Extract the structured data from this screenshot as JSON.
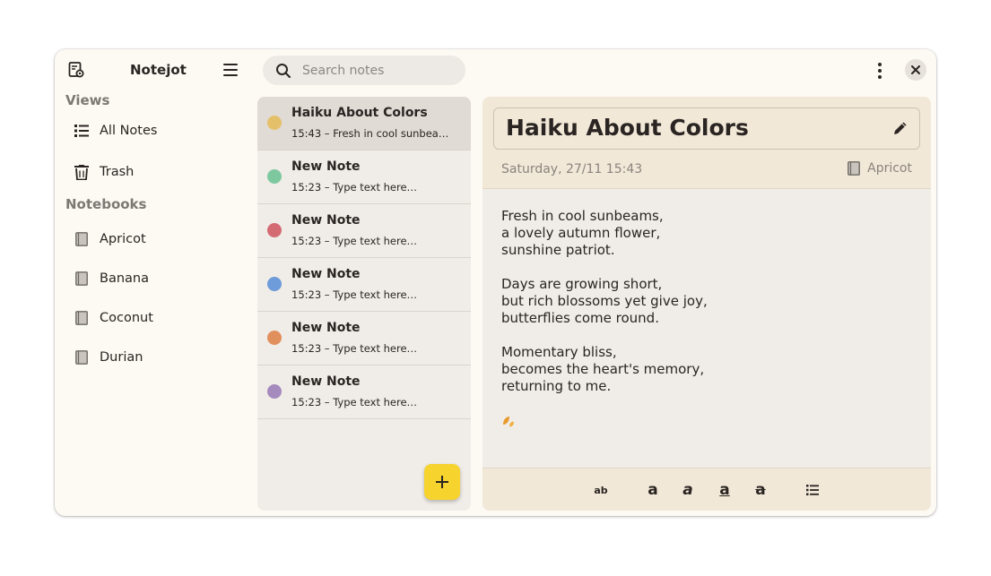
{
  "app": {
    "title": "Notejot"
  },
  "sidebar": {
    "views_title": "Views",
    "views": [
      {
        "label": "All Notes",
        "icon": "list-icon"
      },
      {
        "label": "Trash",
        "icon": "trash-icon"
      }
    ],
    "notebooks_title": "Notebooks",
    "notebooks": [
      {
        "label": "Apricot",
        "icon": "notebook-icon"
      },
      {
        "label": "Banana",
        "icon": "notebook-icon"
      },
      {
        "label": "Coconut",
        "icon": "notebook-icon"
      },
      {
        "label": "Durian",
        "icon": "notebook-icon"
      }
    ]
  },
  "search": {
    "placeholder": "Search notes",
    "value": ""
  },
  "notes": [
    {
      "title": "Haiku About Colors",
      "subtitle": "15:43 – Fresh in cool sunbea…",
      "color": "#e5c06a",
      "selected": true
    },
    {
      "title": "New Note",
      "subtitle": "15:23 – Type text here…",
      "color": "#7ec8a0",
      "selected": false
    },
    {
      "title": "New Note",
      "subtitle": "15:23 – Type text here…",
      "color": "#d46b73",
      "selected": false
    },
    {
      "title": "New Note",
      "subtitle": "15:23 – Type text here…",
      "color": "#6e9bd9",
      "selected": false
    },
    {
      "title": "New Note",
      "subtitle": "15:23 – Type text here…",
      "color": "#e28f5e",
      "selected": false
    },
    {
      "title": "New Note",
      "subtitle": "15:23 – Type text here…",
      "color": "#a58bbd",
      "selected": false
    }
  ],
  "editor": {
    "title": "Haiku About Colors",
    "date": "Saturday, 27/11 15:43",
    "notebook": "Apricot",
    "paragraphs": [
      "Fresh in cool sunbeams,\na lovely autumn flower,\nsunshine patriot.",
      "Days are growing short,\nbut rich blossoms yet give joy,\nbutterflies come round.",
      "Momentary bliss,\nbecomes the heart's memory,\nreturning to me."
    ],
    "emoji": "leaves-icon"
  },
  "toolbar": {
    "normal_label": "ab",
    "bold_label": "a",
    "italic_label": "a",
    "underline_label": "a",
    "strike_label": "a",
    "list_icon": "bullet-list-icon"
  },
  "colors": {
    "accent": "#f6d32d",
    "window_bg": "#fdf9f3",
    "header_bg": "#f2e8d8"
  }
}
